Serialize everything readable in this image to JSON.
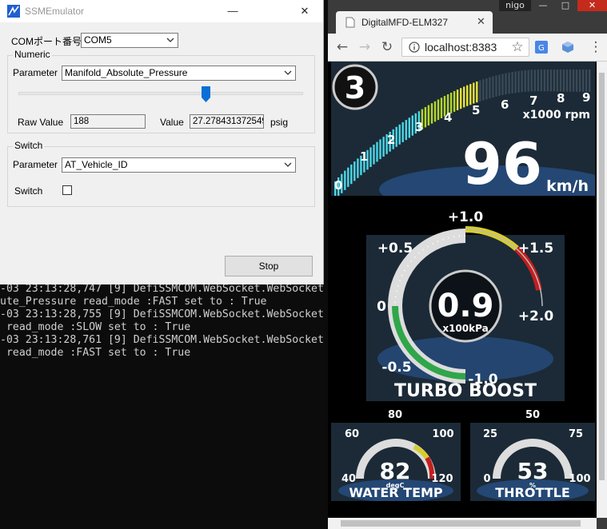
{
  "console": {
    "lines": [
      "-03 23:13:28,747 [9] DefiSSMCOM.WebSocket.WebSocket",
      "ute_Pressure read_mode :FAST set to : True",
      "-03 23:13:28,755 [9] DefiSSMCOM.WebSocket.WebSocket",
      " read_mode :SLOW set to : True",
      "-03 23:13:28,761 [9] DefiSSMCOM.WebSocket.WebSocket",
      " read_mode :FAST set to : True"
    ]
  },
  "emulator": {
    "title": "SSMEmulator",
    "minimize": "—",
    "close": "✕",
    "com_label": "COMポート番号",
    "com_value": "COM5",
    "numeric": {
      "caption": "Numeric",
      "param_label": "Parameter",
      "param_value": "Manifold_Absolute_Pressure",
      "slider_level": 0.66,
      "raw_label": "Raw Value",
      "raw_value": "188",
      "value_label": "Value",
      "value_value": "27.278431372549",
      "unit": "psig"
    },
    "switch": {
      "caption": "Switch",
      "param_label": "Parameter",
      "param_value": "AT_Vehicle_ID",
      "switch_label": "Switch",
      "checked": false
    },
    "stop_label": "Stop"
  },
  "browser": {
    "tab_title": "DigitalMFD-ELM327",
    "tab_close": "✕",
    "user": "nigo",
    "url": "localhost:8383",
    "back": "←",
    "forward": "→",
    "reload": "↻",
    "star": "☆",
    "menu": "⋮"
  },
  "mfd": {
    "logo": "3",
    "tacho": {
      "ticks": [
        "0",
        "1",
        "2",
        "3",
        "4",
        "5",
        "6",
        "7",
        "8",
        "9"
      ],
      "unit": "x1000 rpm",
      "rpm": 5.0
    },
    "speed": {
      "value": "96",
      "unit": "km/h"
    },
    "boost": {
      "ticks": [
        "+1.0",
        "+0.5",
        "+1.5",
        "0",
        "+2.0",
        "-0.5",
        "-1.0"
      ],
      "value": "0.9",
      "unit": "x100kPa",
      "title": "TURBO BOOST"
    },
    "water": {
      "ticks": [
        "80",
        "60",
        "100",
        "40",
        "120"
      ],
      "value": "82",
      "unit": "degC",
      "title": "WATER TEMP"
    },
    "throttle": {
      "ticks": [
        "50",
        "25",
        "75",
        "0",
        "100"
      ],
      "value": "53",
      "unit": "%",
      "title": "THROTTLE"
    }
  },
  "colors": {
    "mfd_bg": "#1b2a36",
    "tacho_low": "#4cd6e6",
    "tacho_mid": "#b5d62a",
    "tacho_high": "#e8e23a",
    "boost_green": "#2fa64a",
    "boost_yellow": "#d8cc2a",
    "boost_red": "#c41e1e"
  }
}
